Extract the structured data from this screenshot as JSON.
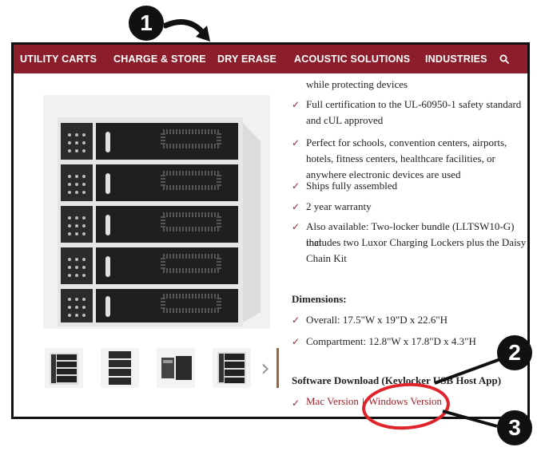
{
  "nav": {
    "items": [
      "UTILITY CARTS",
      "CHARGE & STORE",
      "DRY ERASE",
      "ACOUSTIC SOLUTIONS",
      "INDUSTRIES"
    ],
    "search_icon": "search-icon"
  },
  "features": {
    "partial_line": "while protecting devices",
    "items": [
      [
        "Full certification to the UL-60950-1 safety standard",
        "and cUL approved"
      ],
      [
        "Perfect for schools, convention centers, airports,",
        "hotels, fitness centers, healthcare facilities, or",
        "anywhere electronic devices are used"
      ],
      [
        "Ships fully assembled"
      ],
      [
        "2 year warranty"
      ],
      [
        "Also available: Two-locker bundle (LLTSW10-G) that",
        "includes two Luxor Charging Lockers plus the Daisy",
        "Chain Kit"
      ]
    ]
  },
  "dimensions": {
    "heading": "Dimensions:",
    "overall": "Overall: 17.5\"W x 19\"D x 22.6\"H",
    "compartment": "Compartment: 12.8\"W x 17.8\"D x 4.3\"H"
  },
  "software": {
    "heading": "Software Download (Keylocker USB Host App)",
    "mac_link": "Mac Version",
    "separator": "|",
    "windows_link": "Windows Version"
  },
  "annotations": {
    "marker_1": "1",
    "marker_2": "2",
    "marker_3": "3"
  },
  "check_glyph": "✓",
  "thumb_next_glyph": "›",
  "colors": {
    "nav_bg": "#8c1d2a",
    "accent": "#a1212f",
    "annotation_red": "#e0242c"
  }
}
